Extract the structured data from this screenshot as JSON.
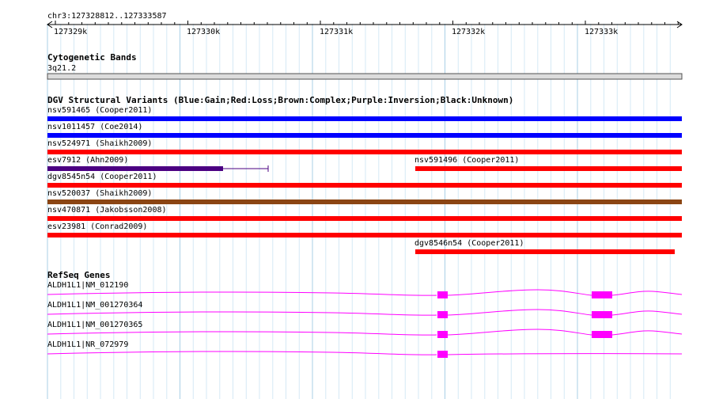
{
  "ruler": {
    "region_label": "chr3:127328812..127333587",
    "tick_labels": [
      "127329k",
      "127330k",
      "127331k",
      "127332k",
      "127333k"
    ]
  },
  "cytoband": {
    "title": "Cytogenetic Bands",
    "band_label": "3q21.2"
  },
  "dgv": {
    "title": "DGV Structural Variants (Blue:Gain;Red:Loss;Brown:Complex;Purple:Inversion;Black:Unknown)",
    "variants": [
      {
        "label": "nsv591465 (Cooper2011)",
        "color": "#0000ff"
      },
      {
        "label": "nsv1011457 (Coe2014)",
        "color": "#0000ff"
      },
      {
        "label": "nsv524971 (Shaikh2009)",
        "color": "#ff0000"
      },
      {
        "label": "esv7912 (Ahn2009)",
        "color": "#4b0082"
      },
      {
        "label": "nsv591496 (Cooper2011)",
        "color": "#ff0000"
      },
      {
        "label": "dgv8545n54 (Cooper2011)",
        "color": "#ff0000"
      },
      {
        "label": "nsv520037 (Shaikh2009)",
        "color": "#8b4513"
      },
      {
        "label": "nsv470871 (Jakobsson2008)",
        "color": "#ff0000"
      },
      {
        "label": "esv23981 (Conrad2009)",
        "color": "#ff0000"
      },
      {
        "label": "dgv8546n54 (Cooper2011)",
        "color": "#ff0000"
      }
    ]
  },
  "refseq": {
    "title": "RefSeq Genes",
    "color": "#ff00ff",
    "genes": [
      {
        "label": "ALDH1L1|NM_012190"
      },
      {
        "label": "ALDH1L1|NM_001270364"
      },
      {
        "label": "ALDH1L1|NM_001270365"
      },
      {
        "label": "ALDH1L1|NR_072979"
      }
    ]
  }
}
